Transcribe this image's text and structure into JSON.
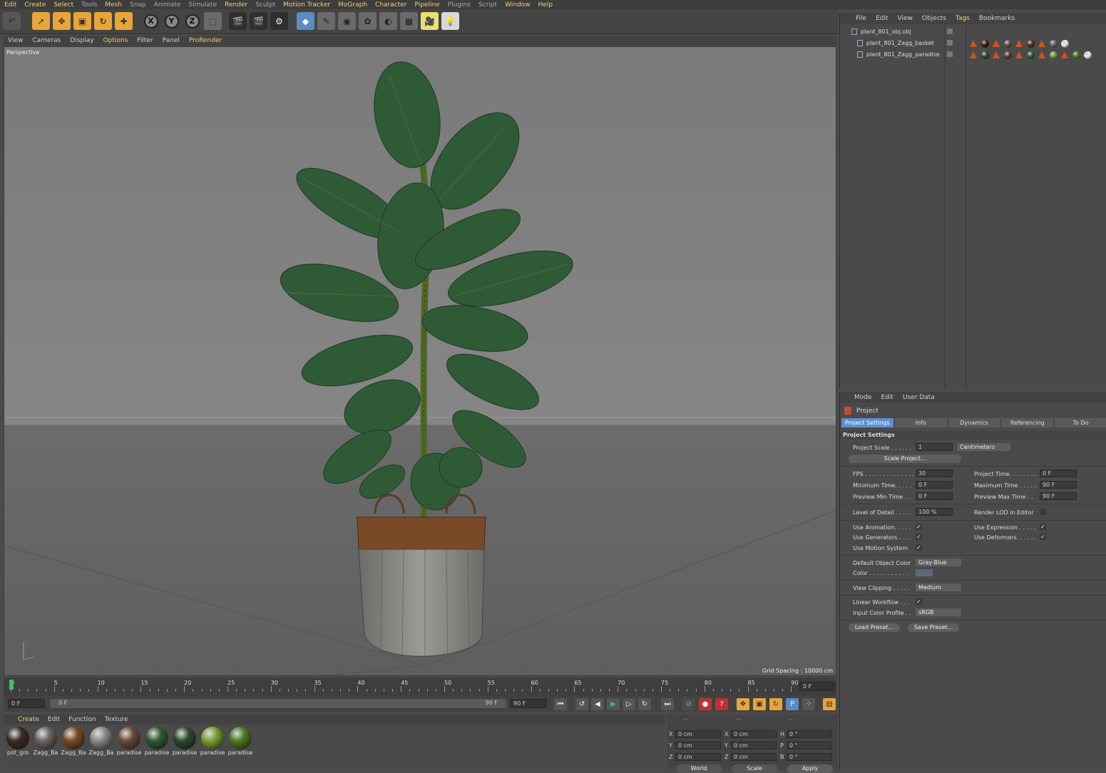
{
  "menubar": [
    "Edit",
    "Create",
    "Select",
    "Tools",
    "Mesh",
    "Snap",
    "Animate",
    "Simulate",
    "Render",
    "Sculpt",
    "Motion Tracker",
    "MoGraph",
    "Character",
    "Pipeline",
    "Plugins",
    "Script",
    "Window",
    "Help"
  ],
  "toolbar": {
    "x": "X",
    "y": "Y",
    "z": "Z"
  },
  "viewport": {
    "menu": [
      "View",
      "Cameras",
      "Display",
      "Options",
      "Filter",
      "Panel",
      "ProRender"
    ],
    "label": "Perspective",
    "grid_spacing": "Grid Spacing : 10000 cm"
  },
  "timeline": {
    "ticks": [
      "0",
      "5",
      "10",
      "15",
      "20",
      "25",
      "30",
      "35",
      "40",
      "45",
      "50",
      "55",
      "60",
      "65",
      "70",
      "75",
      "80",
      "85",
      "90"
    ],
    "current": "0 F",
    "start": "0 F",
    "range_start": "0 F",
    "range_end": "90 F",
    "end": "90 F"
  },
  "materials": {
    "menu": [
      "Create",
      "Edit",
      "Function",
      "Texture"
    ],
    "items": [
      {
        "name": "pot_gro",
        "color": "#3a2a26"
      },
      {
        "name": "Zagg_Ba",
        "color": "#6a6560"
      },
      {
        "name": "Zagg_Ba",
        "color": "#7a4a22"
      },
      {
        "name": "Zagg_Ba",
        "color": "#8a8a8a"
      },
      {
        "name": "paradise",
        "color": "#6a4a3a"
      },
      {
        "name": "paradise",
        "color": "#2f5a32"
      },
      {
        "name": "paradise",
        "color": "#2a4a2c"
      },
      {
        "name": "paradise",
        "color": "#7aa030"
      },
      {
        "name": "paradise",
        "color": "#4a7a22"
      }
    ]
  },
  "coords": {
    "headers": [
      "--",
      "--",
      "--"
    ],
    "rows": [
      {
        "a": "X",
        "av": "0 cm",
        "b": "X",
        "bv": "0 cm",
        "c": "H",
        "cv": "0 °"
      },
      {
        "a": "Y",
        "av": "0 cm",
        "b": "Y",
        "bv": "0 cm",
        "c": "P",
        "cv": "0 °"
      },
      {
        "a": "Z",
        "av": "0 cm",
        "b": "Z",
        "bv": "0 cm",
        "c": "B",
        "cv": "0 °"
      }
    ],
    "world": "World",
    "scale": "Scale",
    "apply": "Apply"
  },
  "objects": {
    "menu": [
      "File",
      "Edit",
      "View",
      "Objects",
      "Tags",
      "Bookmarks"
    ],
    "rows": [
      "plant_801_obj.obj",
      "plant_801_Zagg_basket",
      "plant_801_Zagg_paradise"
    ]
  },
  "attributes": {
    "menu": [
      "Mode",
      "Edit",
      "User Data"
    ],
    "title": "Project",
    "tabs": [
      "Project Settings",
      "Info",
      "Dynamics",
      "Referencing",
      "To Do"
    ],
    "section": "Project Settings",
    "project_scale_label": "Project Scale . . . . . .",
    "project_scale_value": "1",
    "project_scale_unit": "Centimeters",
    "scale_project_btn": "Scale Project...",
    "fps_label": "FPS . . . . . . . . . . . . . .",
    "fps": "30",
    "project_time_label": "Project Time. . . . . . . .",
    "project_time": "0 F",
    "min_time_label": "Minimum Time. . . . .",
    "min_time": "0 F",
    "max_time_label": "Maximum Time . . . . .",
    "max_time": "90 F",
    "prev_min_label": "Preview Min Time . .",
    "prev_min": "0 F",
    "prev_max_label": "Preview Max Time . .",
    "prev_max": "90 F",
    "lod_label": "Level of Detail . . . . .",
    "lod": "100 %",
    "render_lod_label": "Render LOD in Editor",
    "use_anim_label": "Use Animation. . . . .",
    "use_expr_label": "Use Expression . . . . .",
    "use_gen_label": "Use Generators . . . .",
    "use_def_label": "Use Deformers. . . . . .",
    "use_motion_label": "Use Motion System",
    "def_color_label": "Default Object Color",
    "def_color": "Gray-Blue",
    "color_label": "Color . . . . . . . . . . .",
    "view_clip_label": "View Clipping . . . . .",
    "view_clip": "Medium",
    "linear_label": "Linear Workflow . . .",
    "input_profile_label": "Input Color Profile . .",
    "input_profile": "sRGB",
    "load_preset": "Load Preset...",
    "save_preset": "Save Preset...",
    "check": "✓"
  }
}
